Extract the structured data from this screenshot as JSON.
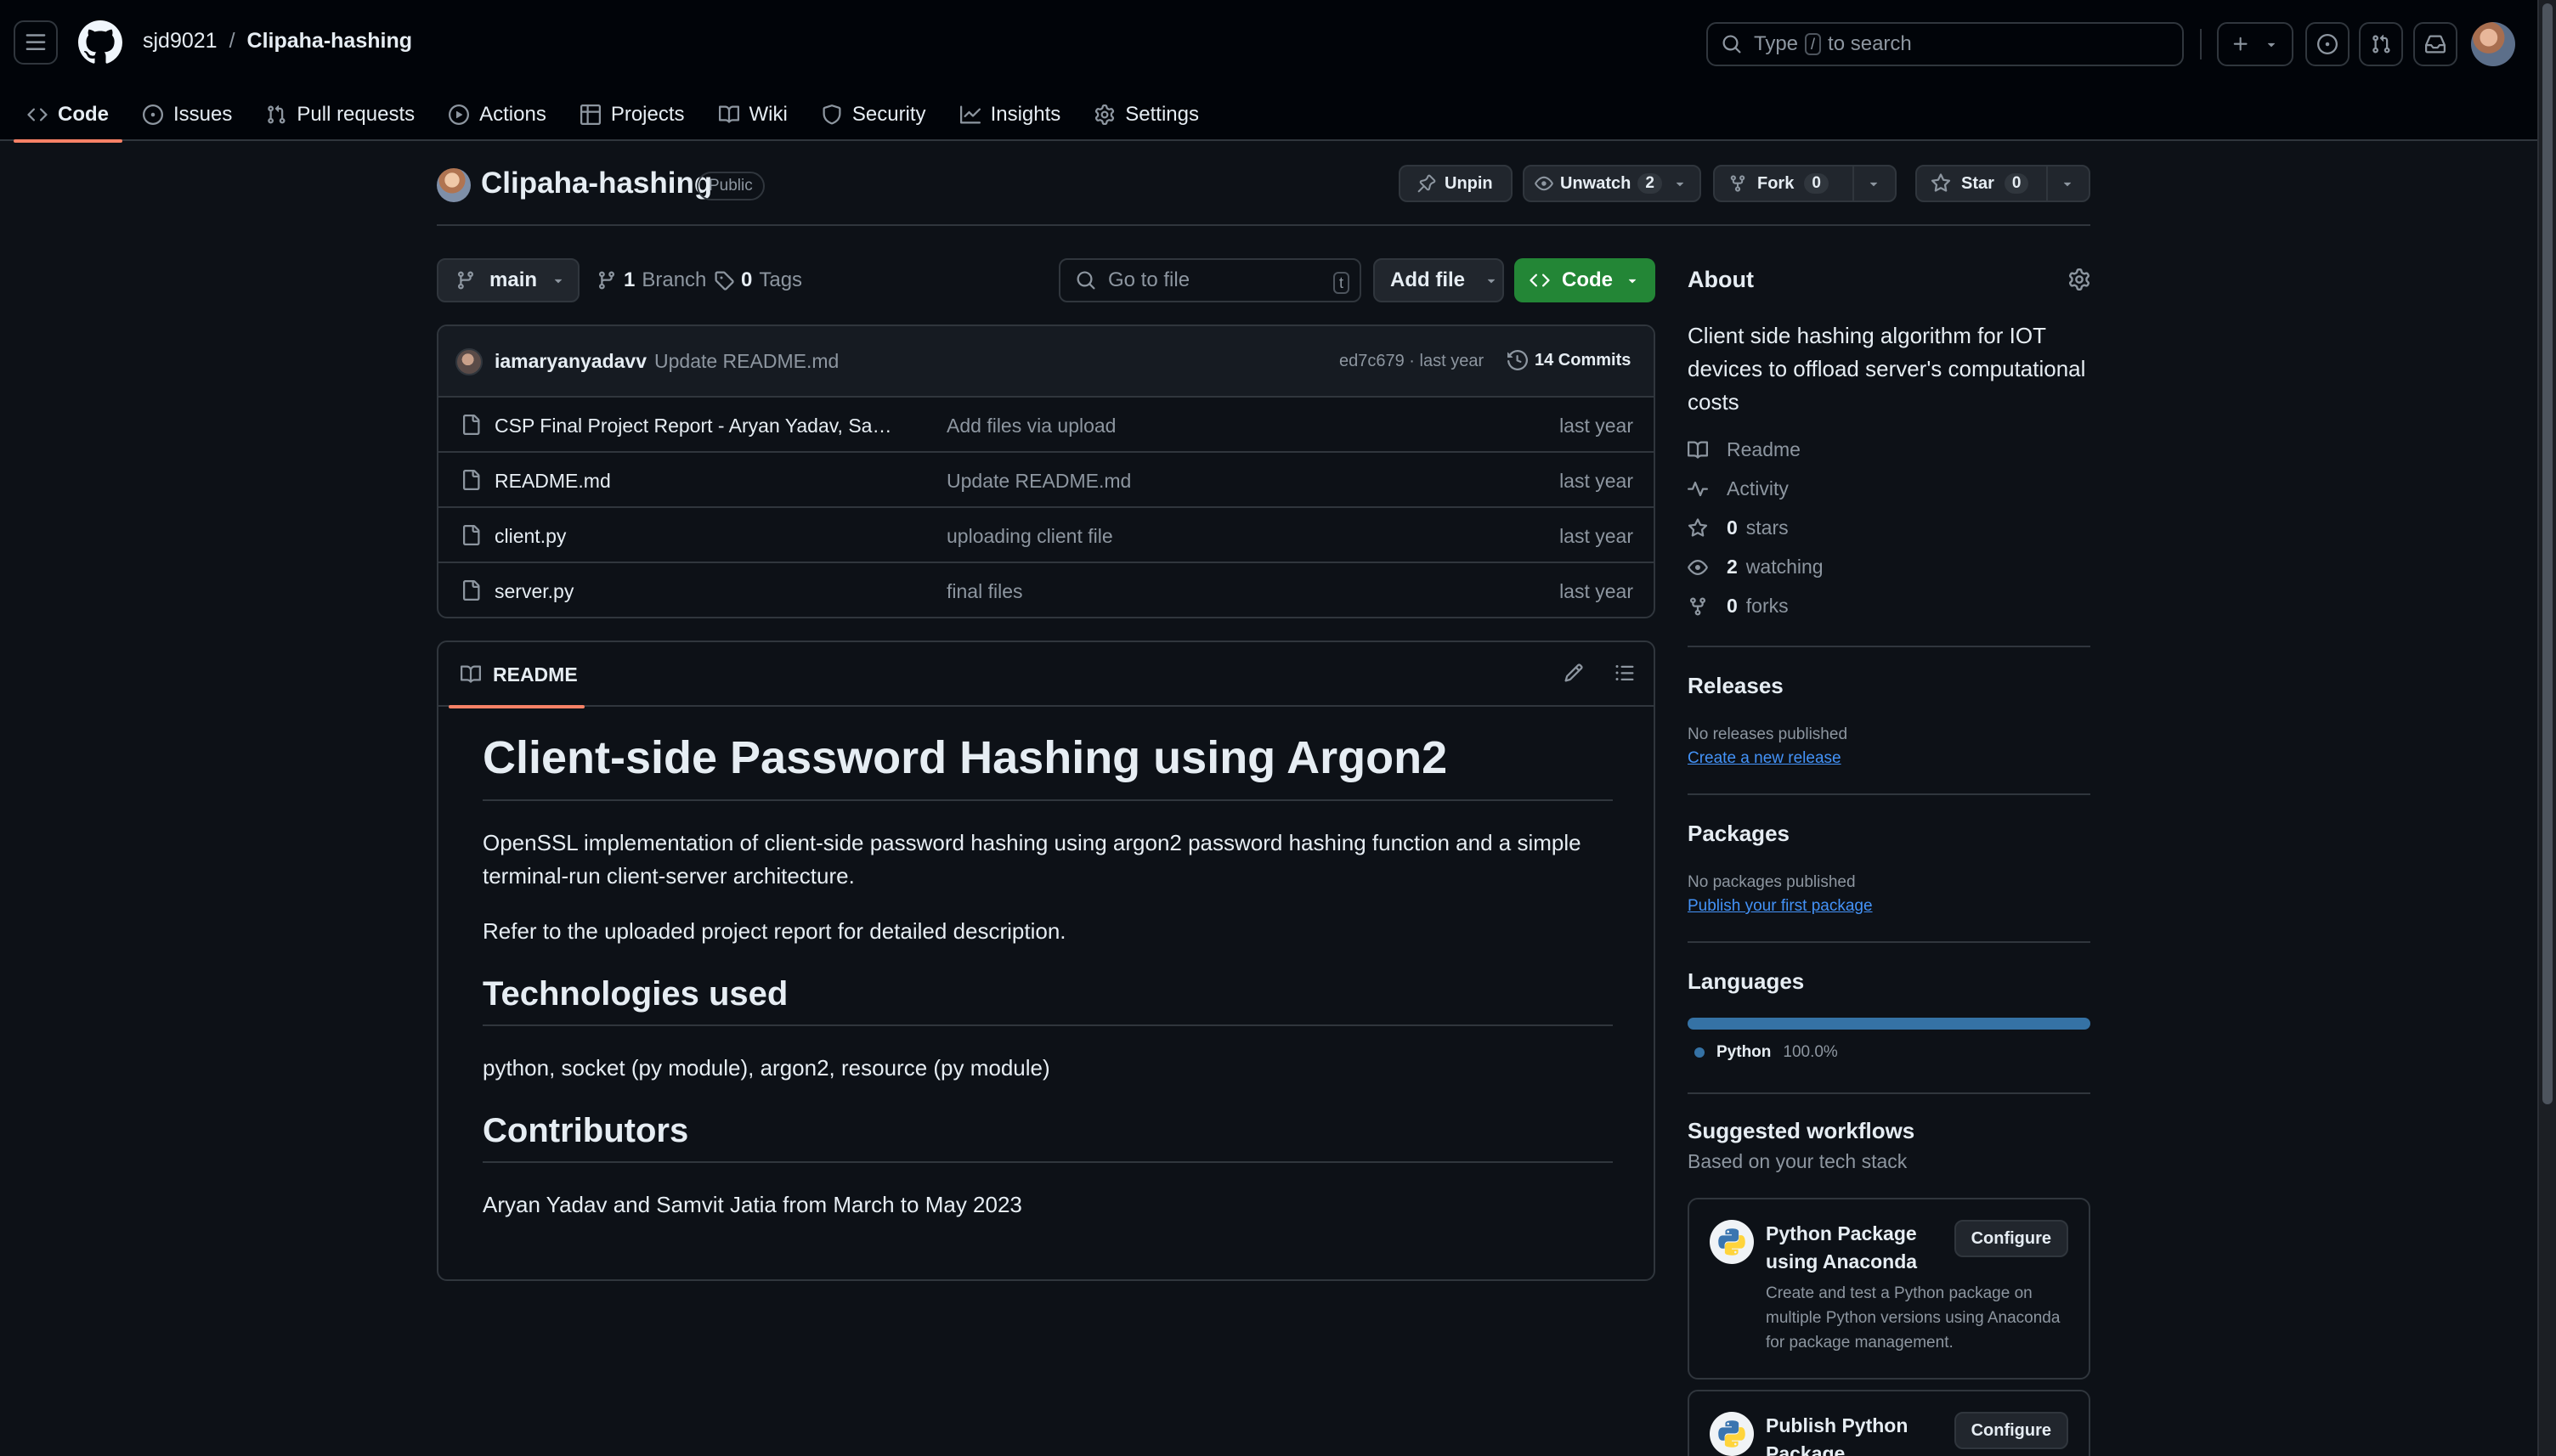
{
  "header": {
    "owner": "sjd9021",
    "separator": "/",
    "repo": "Clipaha-hashing",
    "search_prefix": "Type",
    "search_key": "/",
    "search_suffix": "to search"
  },
  "nav": {
    "tabs": [
      {
        "label": "Code",
        "icon": "code-icon"
      },
      {
        "label": "Issues",
        "icon": "issue-icon"
      },
      {
        "label": "Pull requests",
        "icon": "pull-request-icon"
      },
      {
        "label": "Actions",
        "icon": "play-icon"
      },
      {
        "label": "Projects",
        "icon": "table-icon"
      },
      {
        "label": "Wiki",
        "icon": "book-icon"
      },
      {
        "label": "Security",
        "icon": "shield-icon"
      },
      {
        "label": "Insights",
        "icon": "graph-icon"
      },
      {
        "label": "Settings",
        "icon": "gear-icon"
      }
    ]
  },
  "repo": {
    "name": "Clipaha-hashing",
    "visibility": "Public",
    "unpin_label": "Unpin",
    "unwatch_label": "Unwatch",
    "watch_count": "2",
    "fork_label": "Fork",
    "fork_count": "0",
    "star_label": "Star",
    "star_count": "0"
  },
  "toolbar": {
    "branch": "main",
    "branches_count": "1",
    "branches_label": "Branch",
    "tags_count": "0",
    "tags_label": "Tags",
    "goto_placeholder": "Go to file",
    "goto_key": "t",
    "add_file_label": "Add file",
    "code_label": "Code"
  },
  "commit": {
    "author": "iamaryanyadavv",
    "message": "Update README.md",
    "meta": "ed7c679 · last year",
    "commits_label": "14 Commits"
  },
  "files": [
    {
      "name": "CSP Final Project Report - Aryan Yadav, Samvit Jatia.pdf",
      "display": "CSP Final Project Report - Aryan Yadav, Sam…",
      "commit": "Add files via upload",
      "date": "last year"
    },
    {
      "name": "README.md",
      "display": "README.md",
      "commit": "Update README.md",
      "date": "last year"
    },
    {
      "name": "client.py",
      "display": "client.py",
      "commit": "uploading client file",
      "date": "last year"
    },
    {
      "name": "server.py",
      "display": "server.py",
      "commit": "final files",
      "date": "last year"
    }
  ],
  "readme": {
    "tab_label": "README",
    "h1": "Client-side Password Hashing using Argon2",
    "p1": "OpenSSL implementation of client-side password hashing using argon2 password hashing function and a simple terminal-run client-server architecture.",
    "p2": "Refer to the uploaded project report for detailed description.",
    "h2_tech": "Technologies used",
    "p_tech": "python, socket (py module), argon2, resource (py module)",
    "h2_contrib": "Contributors",
    "p_contrib": "Aryan Yadav and Samvit Jatia from March to May 2023"
  },
  "about": {
    "title": "About",
    "description": "Client side hashing algorithm for IOT devices to offload server's computational costs",
    "readme": "Readme",
    "activity": "Activity",
    "stars_count": "0",
    "stars_label": "stars",
    "watching_count": "2",
    "watching_label": "watching",
    "forks_count": "0",
    "forks_label": "forks"
  },
  "releases": {
    "title": "Releases",
    "none": "No releases published",
    "create": "Create a new release"
  },
  "packages": {
    "title": "Packages",
    "none": "No packages published",
    "publish": "Publish your first package"
  },
  "languages": {
    "title": "Languages",
    "items": [
      {
        "name": "Python",
        "percent": "100.0%",
        "color": "#3572a5"
      }
    ]
  },
  "workflows": {
    "title": "Suggested workflows",
    "subtitle": "Based on your tech stack",
    "items": [
      {
        "title": "Python Package using Anaconda",
        "description": "Create and test a Python package on multiple Python versions using Anaconda for package management.",
        "button": "Configure"
      },
      {
        "title": "Publish Python Package",
        "description": "",
        "button": "Configure"
      }
    ]
  },
  "colors": {
    "accent_green": "#238636",
    "link_blue": "#4493f8",
    "tab_underline": "#f78166",
    "python": "#3572a5"
  }
}
